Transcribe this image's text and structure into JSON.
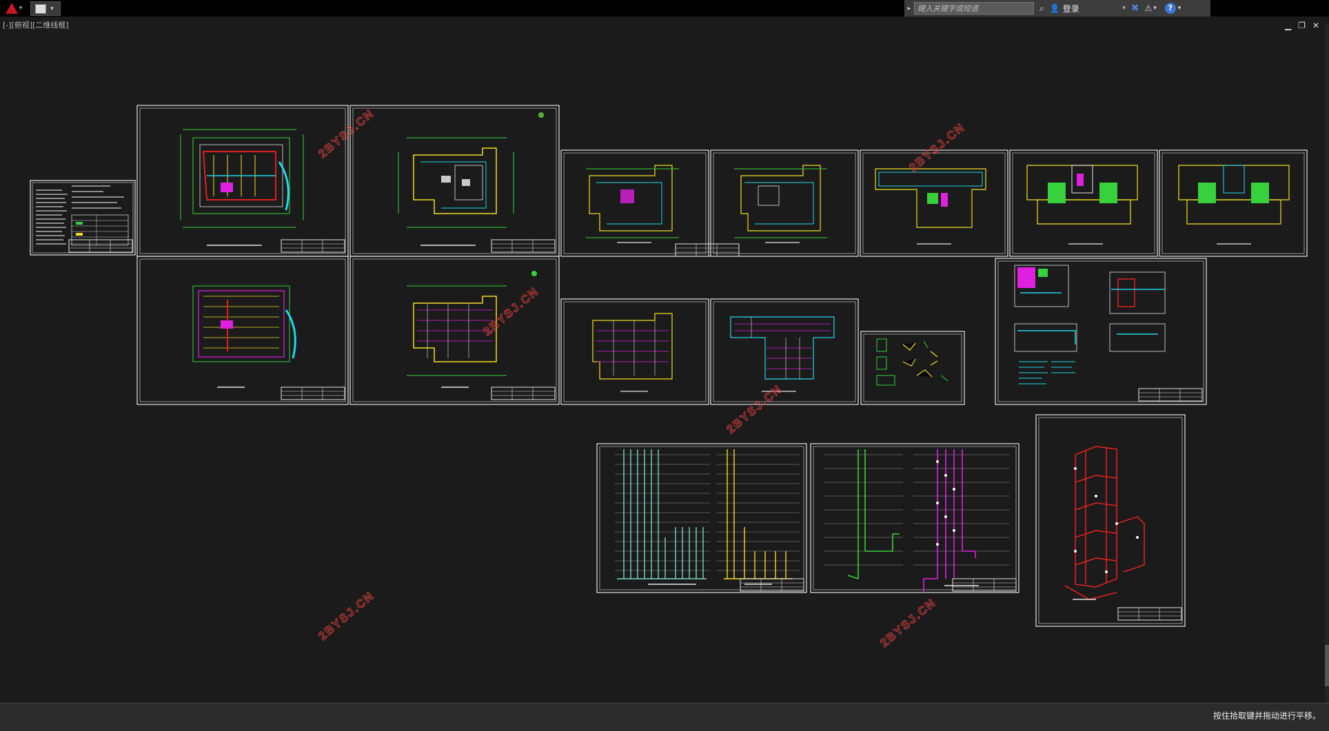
{
  "titlebar": {
    "search_placeholder": "键入关键字或短语",
    "login_label": "登录"
  },
  "viewport": {
    "label": "[-][俯视][二维线框]"
  },
  "watermarks": [
    "2BYSJ.CN",
    "2BYSJ.CN",
    "2BYSJ.CN",
    "2BYSJ.CN",
    "2BYSJ.CN",
    "2BYSJ.CN"
  ],
  "statusbar": {
    "prompt": "按住拾取键并拖动进行平移。"
  },
  "colors": {
    "background": "#1b1b1b",
    "sheet_border": "#e6e6e6",
    "axis_green": "#36d13b",
    "pipe_red": "#e02020",
    "pipe_yellow": "#f0e020",
    "pipe_cyan": "#20d8e8",
    "pipe_magenta": "#e020e0",
    "watermark": "#e04040"
  }
}
